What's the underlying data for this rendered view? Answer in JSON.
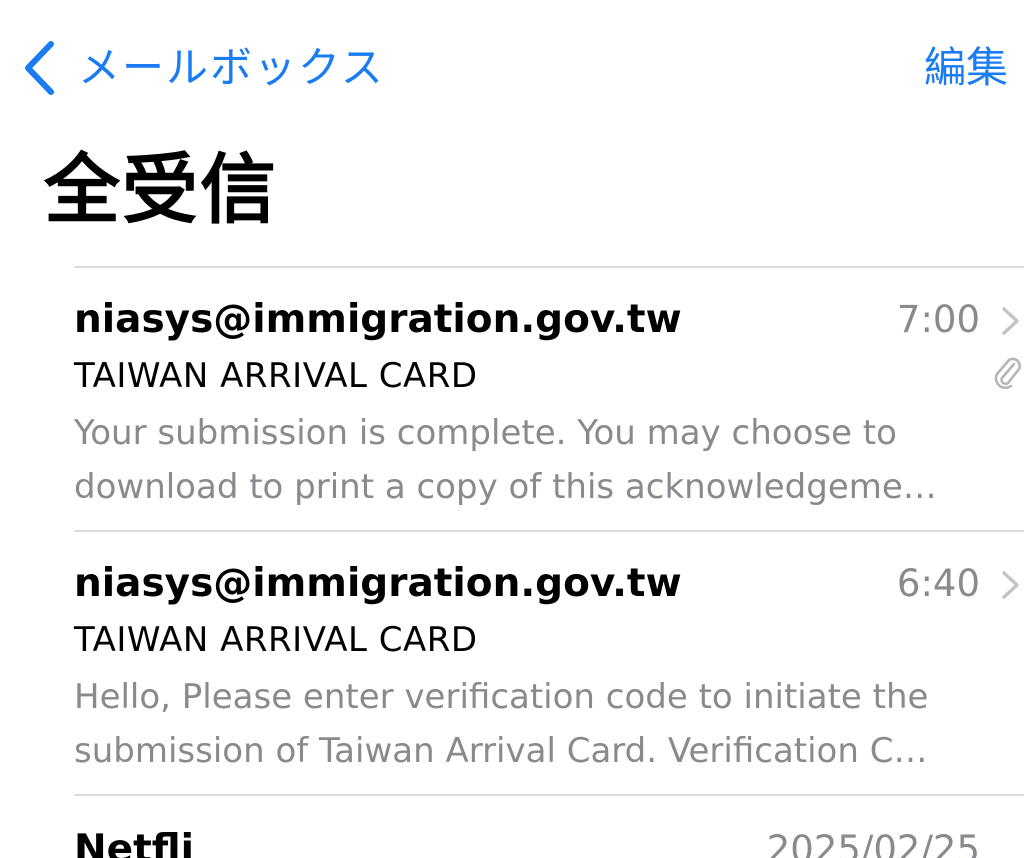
{
  "nav": {
    "back_label": "メールボックス",
    "edit_label": "編集"
  },
  "title": "全受信",
  "mails": [
    {
      "sender": "niasys@immigration.gov.tw",
      "time": "7:00",
      "subject": "TAIWAN ARRIVAL CARD",
      "preview_line1": "Your submission is complete. You may choose to",
      "preview_line2": "download to print a copy of this acknowledgeme…",
      "has_attachment": true
    },
    {
      "sender": "niasys@immigration.gov.tw",
      "time": "6:40",
      "subject": "TAIWAN ARRIVAL CARD",
      "preview_line1": "Hello, Please enter verification code to initiate the",
      "preview_line2": "submission of Taiwan Arrival Card. Verification C…",
      "has_attachment": false
    }
  ],
  "partial_mail": {
    "sender": "Netfli",
    "time": "2025/02/25"
  },
  "colors": {
    "accent": "#1a7cf2",
    "secondary_text": "#8a8a8e",
    "separator": "#dcdcde"
  },
  "icons": {
    "back": "chevron-left-icon",
    "disclosure": "chevron-right-icon",
    "attachment": "paperclip-icon"
  }
}
